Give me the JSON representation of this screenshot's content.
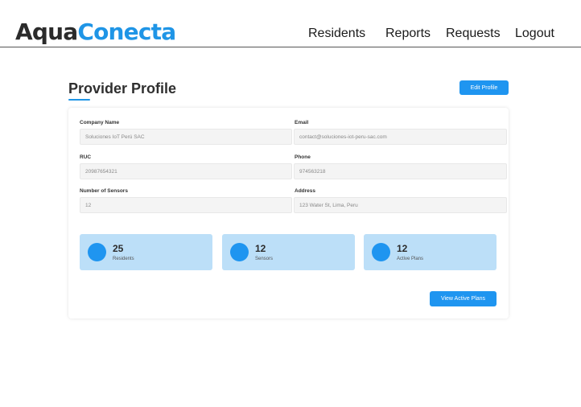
{
  "brand": {
    "part1": "Aqua",
    "part2": "Conecta"
  },
  "nav": {
    "residents": "Residents",
    "reports": "Reports",
    "requests": "Requests",
    "logout": "Logout"
  },
  "page": {
    "title": "Provider Profile",
    "edit_button": "Edit Profile"
  },
  "profile": {
    "company_name": {
      "label": "Company Name",
      "value": "Soluciones IoT Perú SAC"
    },
    "email": {
      "label": "Email",
      "value": "contact@soluciones-iot-peru-sac.com"
    },
    "ruc": {
      "label": "RUC",
      "value": "20987654321"
    },
    "phone": {
      "label": "Phone",
      "value": "974563218"
    },
    "sensors": {
      "label": "Number of Sensors",
      "value": "12"
    },
    "address": {
      "label": "Address",
      "value": "123 Water St, Lima, Peru"
    }
  },
  "stats": [
    {
      "value": "25",
      "label": "Residents"
    },
    {
      "value": "12",
      "label": "Sensors"
    },
    {
      "value": "12",
      "label": "Active Plans"
    }
  ],
  "actions": {
    "view_plans": "View Active Plans"
  },
  "colors": {
    "accent": "#1f95f0",
    "stat_bg": "#bcdff8"
  }
}
